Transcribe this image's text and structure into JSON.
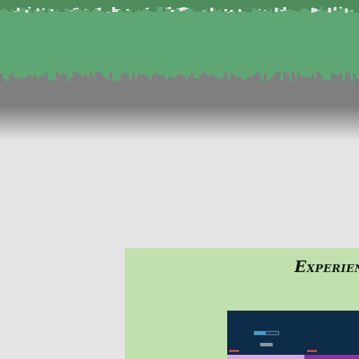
{
  "colors": {
    "page_background": "#e4e4e4",
    "banner_top_strip": "#4e8c5c",
    "banner_green": "#5ea673",
    "banner_grey": "#7f7f7f",
    "card_background": "#c0e0ae",
    "preview_background": "#0c2c48"
  },
  "card": {
    "heading": "Experien"
  },
  "preview": {
    "title": "",
    "note": "",
    "button_label": ""
  }
}
